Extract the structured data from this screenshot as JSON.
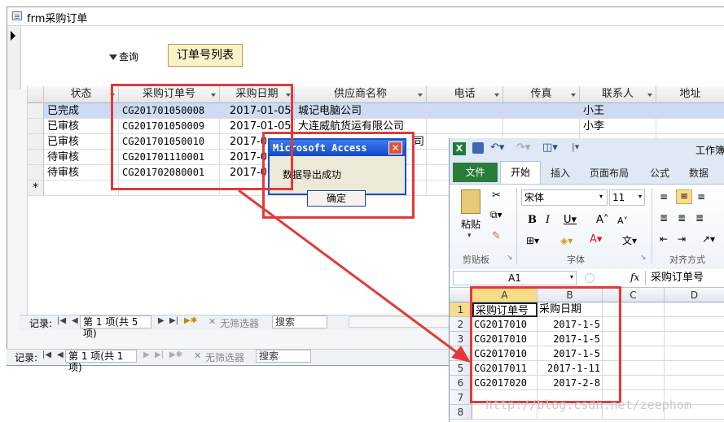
{
  "access": {
    "title": "frm采购订单",
    "filter_label": "查询",
    "order_list_button": "订单号列表",
    "columns": [
      "状态",
      "采购订单号",
      "采购日期",
      "供应商名称",
      "电话",
      "传真",
      "联系人",
      "地址"
    ],
    "rows": [
      {
        "status": "已完成",
        "order_no": "CG201701050008",
        "date": "2017-01-05",
        "supplier": "城记电脑公司",
        "phone": "",
        "fax": "",
        "contact": "小王",
        "address": ""
      },
      {
        "status": "已审核",
        "order_no": "CG201701050009",
        "date": "2017-01-05",
        "supplier": "大连威航货运有限公司",
        "phone": "",
        "fax": "",
        "contact": "小李",
        "address": ""
      },
      {
        "status": "已审核",
        "order_no": "CG201701050010",
        "date": "2017-0",
        "supplier": "司",
        "phone": "",
        "fax": "",
        "contact": "",
        "address": ""
      },
      {
        "status": "待审核",
        "order_no": "CG201701110001",
        "date": "2017-0",
        "supplier": "",
        "phone": "",
        "fax": "",
        "contact": "",
        "address": ""
      },
      {
        "status": "待审核",
        "order_no": "CG201702080001",
        "date": "2017-0",
        "supplier": "",
        "phone": "",
        "fax": "",
        "contact": "",
        "address": ""
      }
    ],
    "new_row_marker": "*",
    "nav1": {
      "label": "记录:",
      "position": "第 1 项(共 5 项)",
      "filter": "无筛选器",
      "search": "搜索"
    },
    "nav2": {
      "label": "记录:",
      "position": "第 1 项(共 1 项)",
      "filter": "无筛选器",
      "search": "搜索"
    }
  },
  "msgbox": {
    "title": "Microsoft Access",
    "message": "数据导出成功",
    "ok": "确定"
  },
  "excel": {
    "title_partial": "工作簿",
    "tabs": [
      "文件",
      "开始",
      "插入",
      "页面布局",
      "公式",
      "数据"
    ],
    "clipboard": {
      "paste": "粘贴",
      "group": "剪贴板"
    },
    "font": {
      "name": "宋体",
      "size": "11",
      "group": "字体"
    },
    "alignment_group": "对齐方式",
    "name_box": "A1",
    "fx": "fx",
    "formula": "采购订单号",
    "col_headers": [
      "A",
      "B",
      "C",
      "D"
    ],
    "row_headers": [
      "1",
      "2",
      "3",
      "4",
      "5",
      "6",
      "7",
      "8"
    ],
    "cells": [
      [
        "采购订单号",
        "采购日期",
        "",
        ""
      ],
      [
        "CG2017010",
        "2017-1-5",
        "",
        ""
      ],
      [
        "CG2017010",
        "2017-1-5",
        "",
        ""
      ],
      [
        "CG2017010",
        "2017-1-5",
        "",
        ""
      ],
      [
        "CG2017011",
        "2017-1-11",
        "",
        ""
      ],
      [
        "CG2017020",
        "2017-2-8",
        "",
        ""
      ],
      [
        "",
        "",
        "",
        ""
      ],
      [
        "",
        "",
        "",
        ""
      ]
    ]
  },
  "watermark": "http://blog.csdn.net/zeephom",
  "colors": {
    "annotation_red": "#e23a3a",
    "selected_row": "#cddcf3",
    "excel_file_green": "#2a7d38",
    "button_bg": "#fbf2c8"
  }
}
